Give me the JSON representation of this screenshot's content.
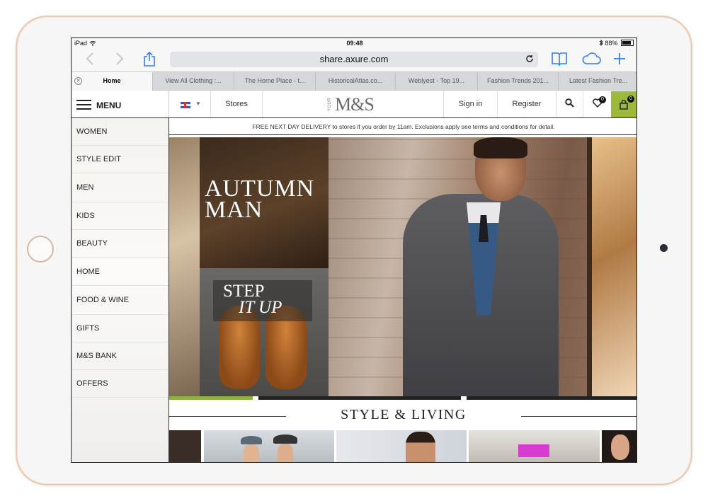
{
  "device": {
    "name": "iPad"
  },
  "status_bar": {
    "time": "09:48",
    "battery": "88%"
  },
  "browser": {
    "url": "share.axure.com",
    "tabs": [
      {
        "label": "Home",
        "active": true
      },
      {
        "label": "View All Clothing :..."
      },
      {
        "label": "The Home Place - t..."
      },
      {
        "label": "HistoricalAtlas.co..."
      },
      {
        "label": "Weblyest - Top 19..."
      },
      {
        "label": "Fashion Trends 201..."
      },
      {
        "label": "Latest Fashion Tre..."
      }
    ]
  },
  "header": {
    "menu_label": "MENU",
    "stores": "Stores",
    "logo_prefix": "YOUR",
    "logo": "M&S",
    "sign_in": "Sign in",
    "register": "Register",
    "wishlist_count": "0",
    "basket_count": "0",
    "accent": "#9cb93b"
  },
  "sidebar": {
    "items": [
      {
        "label": "WOMEN"
      },
      {
        "label": "STYLE EDIT"
      },
      {
        "label": "MEN"
      },
      {
        "label": "KIDS"
      },
      {
        "label": "BEAUTY"
      },
      {
        "label": "HOME"
      },
      {
        "label": "FOOD & WINE"
      },
      {
        "label": "GIFTS"
      },
      {
        "label": "M&S BANK"
      },
      {
        "label": "OFFERS"
      }
    ]
  },
  "promo": {
    "text": "FREE NEXT DAY DELIVERY to stores if you order by 11am. Exclusions apply see terms and conditions for detail."
  },
  "hero": {
    "title_line1": "AUTUMN",
    "title_line2": "MAN",
    "sub_line1": "STEP",
    "sub_line2": "IT UP"
  },
  "section": {
    "title": "STYLE & LIVING"
  },
  "icons": [
    "back-icon",
    "forward-icon",
    "share-icon",
    "reload-icon",
    "bookmarks-icon",
    "cloud-icon",
    "new-tab-icon",
    "tab-close-icon",
    "hamburger-icon",
    "flag-uk-icon",
    "caret-down-icon",
    "search-icon",
    "heart-icon",
    "basket-icon",
    "wifi-icon",
    "bluetooth-icon",
    "battery-icon"
  ]
}
